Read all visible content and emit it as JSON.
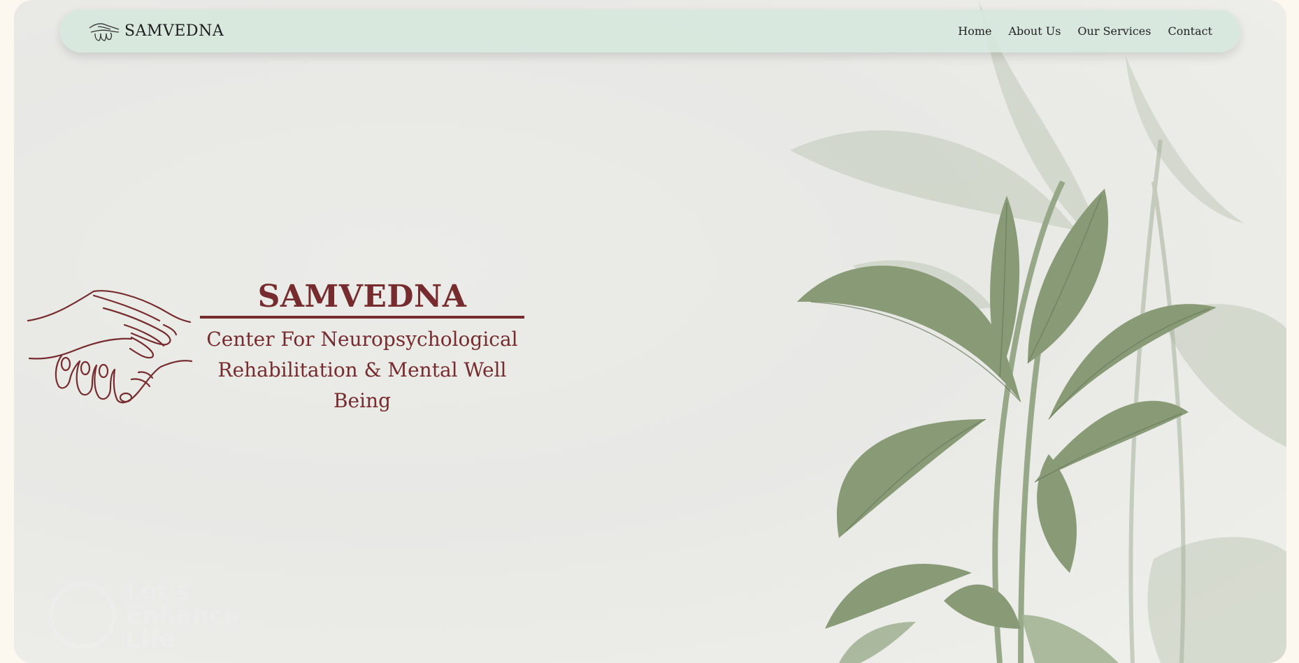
{
  "brand": {
    "name": "SAMVEDNA",
    "logo_icon": "hands-icon"
  },
  "nav": {
    "items": [
      {
        "label": "Home"
      },
      {
        "label": "About Us"
      },
      {
        "label": "Our Services"
      },
      {
        "label": "Contact"
      }
    ]
  },
  "hero": {
    "title": "SAMVEDNA",
    "subtitle_line1": "Center For Neuropsychological",
    "subtitle_line2": "Rehabilitation & Mental Well Being",
    "icon": "helping-hands-icon"
  },
  "watermark": {
    "line1": "Let's",
    "line2": "Enhance",
    "line3": "Life"
  },
  "colors": {
    "page_bg": "#fdf8ef",
    "navbar_bg": "#d6e8dc",
    "accent_maroon": "#762c2e",
    "leaf_green": "#8fa57f"
  }
}
